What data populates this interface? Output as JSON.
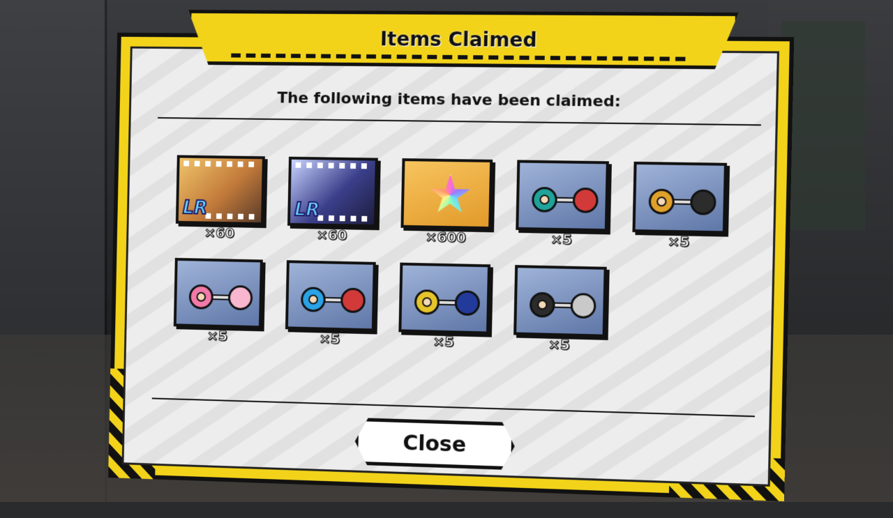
{
  "dialog": {
    "title": "Items Claimed",
    "subtitle": "The following items have been claimed:",
    "close_label": "Close"
  },
  "items": [
    {
      "name": "LR film",
      "icon": "lr-scene-film-icon",
      "quantity": "×60",
      "badge": "LR"
    },
    {
      "name": "LR film",
      "icon": "lr-scene-film-icon",
      "quantity": "×60",
      "badge": "LR"
    },
    {
      "name": "crystal",
      "icon": "rainbow-star-crystal-icon",
      "quantity": "×600"
    },
    {
      "name": "dumbbell-green-red",
      "icon": "dumbbell-icon",
      "quantity": "×5",
      "colors": [
        "#1fa39a",
        "#d23a3a"
      ]
    },
    {
      "name": "dumbbell-gold-black",
      "icon": "dumbbell-icon",
      "quantity": "×5",
      "colors": [
        "#e0a12a",
        "#2c2c2c"
      ]
    },
    {
      "name": "dumbbell-pink",
      "icon": "dumbbell-icon",
      "quantity": "×5",
      "colors": [
        "#f27aa8",
        "#f9b6cf"
      ]
    },
    {
      "name": "dumbbell-blue-red",
      "icon": "dumbbell-icon",
      "quantity": "×5",
      "colors": [
        "#2aa2e6",
        "#d23a3a"
      ]
    },
    {
      "name": "dumbbell-yellow-navy",
      "icon": "dumbbell-icon",
      "quantity": "×5",
      "colors": [
        "#e6c52a",
        "#223a9a"
      ]
    },
    {
      "name": "dumbbell-black-silver",
      "icon": "dumbbell-icon",
      "quantity": "×5",
      "colors": [
        "#2b2b2b",
        "#c9c9c9"
      ]
    }
  ],
  "colors": {
    "frame_yellow": "#f2d31a",
    "panel_bg": "#ededed",
    "outline": "#111111"
  }
}
